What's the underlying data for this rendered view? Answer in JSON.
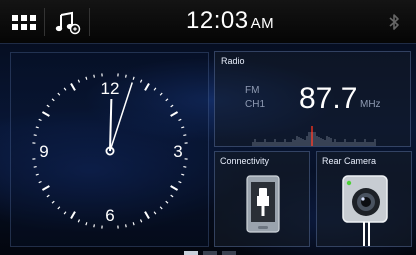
{
  "topbar": {
    "time": "12:03",
    "ampm": "AM",
    "icons": [
      "menu-grid-icon",
      "music-note-icon",
      "bluetooth-icon"
    ]
  },
  "clock_widget": {
    "numerals": [
      "12",
      "3",
      "6",
      "9"
    ],
    "hour": 12,
    "minute": 3
  },
  "radio": {
    "title": "Radio",
    "band": "FM",
    "channel": "CH1",
    "frequency": "87.7",
    "unit": "MHz"
  },
  "connectivity": {
    "title": "Connectivity",
    "icon": "usb-phone-icon"
  },
  "rear_camera": {
    "title": "Rear Camera",
    "icon": "camera-icon"
  },
  "pager": {
    "pages": 3,
    "active": 0
  },
  "colors": {
    "accent_blue": "#2a5bd7",
    "tuner_marker": "#e0301e",
    "cam_led": "#4cd137"
  }
}
